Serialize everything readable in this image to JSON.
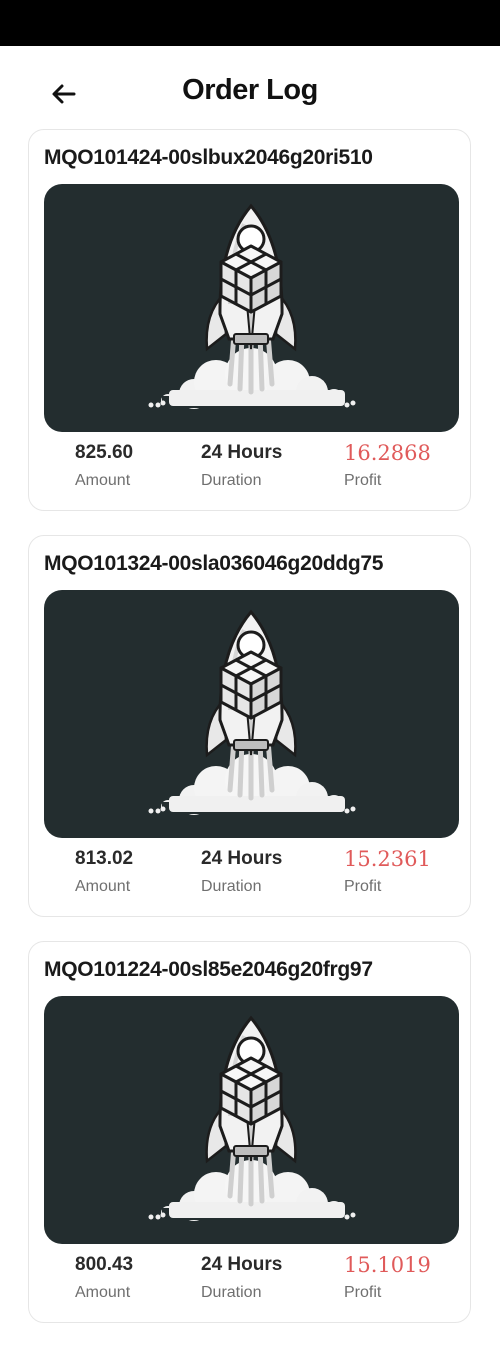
{
  "header": {
    "title": "Order Log",
    "back_icon": "arrow-left-icon"
  },
  "orders": [
    {
      "id": "MQO101424-00slbux2046g20ri510",
      "amount": "825.60",
      "duration": "24 Hours",
      "profit": "16.2868",
      "labels": {
        "amount": "Amount",
        "duration": "Duration",
        "profit": "Profit"
      }
    },
    {
      "id": "MQO101324-00sla036046g20ddg75",
      "amount": "813.02",
      "duration": "24 Hours",
      "profit": "15.2361",
      "labels": {
        "amount": "Amount",
        "duration": "Duration",
        "profit": "Profit"
      }
    },
    {
      "id": "MQO101224-00sl85e2046g20frg97",
      "amount": "800.43",
      "duration": "24 Hours",
      "profit": "15.1019",
      "labels": {
        "amount": "Amount",
        "duration": "Duration",
        "profit": "Profit"
      }
    }
  ],
  "colors": {
    "image_background": "#232d2f",
    "profit": "#e05a5a",
    "status_bar": "#000000"
  }
}
